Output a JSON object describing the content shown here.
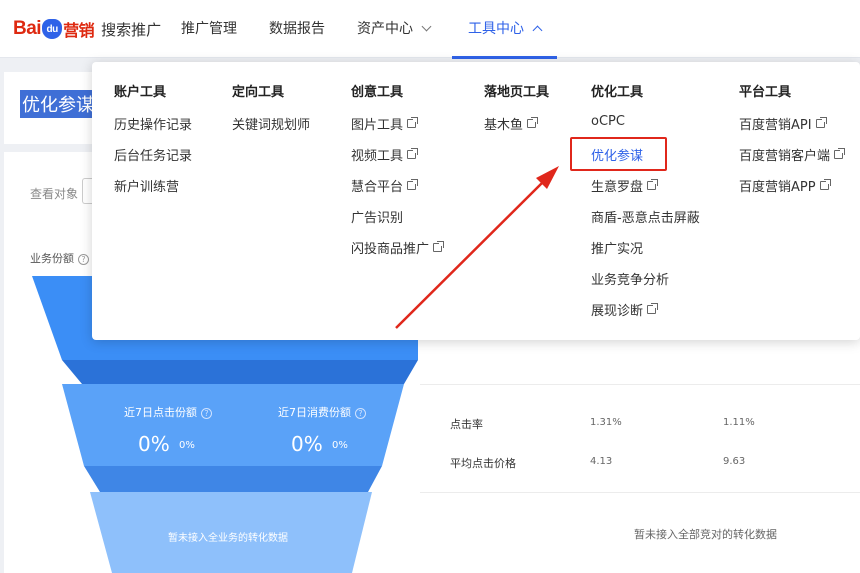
{
  "header": {
    "logo_text_1": "Bai",
    "logo_paw": "du",
    "logo_text_2": "营销",
    "product": "搜索推广",
    "nav": [
      {
        "label": "推广管理"
      },
      {
        "label": "数据报告"
      },
      {
        "label": "资产中心"
      },
      {
        "label": "工具中心"
      }
    ]
  },
  "page": {
    "title": "优化参谋",
    "view_label": "查看对象",
    "share_label": "业务份额",
    "funnel": {
      "click_share_label": "近7日点击份额",
      "click_share_value": "0%",
      "click_share_sub": "0%",
      "cost_share_label": "近7日消费份额",
      "cost_share_value": "0%",
      "cost_share_sub": "0%",
      "conversion_note": "暂未接入全业务的转化数据"
    },
    "table": {
      "rows": [
        {
          "name": "点击率",
          "v1": "1.31%",
          "v2": "1.11%"
        },
        {
          "name": "平均点击价格",
          "v1": "4.13",
          "v2": "9.63"
        }
      ],
      "empty_note": "暂未接入全部竞对的转化数据"
    }
  },
  "dropdown": {
    "columns": [
      {
        "title": "账户工具",
        "items": [
          "历史操作记录",
          "后台任务记录",
          "新户训练营"
        ]
      },
      {
        "title": "定向工具",
        "items": [
          "关键词规划师"
        ]
      },
      {
        "title": "创意工具",
        "items": [
          "图片工具",
          "视频工具",
          "慧合平台",
          "广告识别",
          "闪投商品推广"
        ]
      },
      {
        "title": "落地页工具",
        "items": [
          "基木鱼"
        ]
      },
      {
        "title": "优化工具",
        "items": [
          "oCPC",
          "优化参谋",
          "生意罗盘",
          "商盾-恶意点击屏蔽",
          "推广实况",
          "业务竞争分析",
          "展现诊断"
        ]
      },
      {
        "title": "平台工具",
        "items": [
          "百度营销API",
          "百度营销客户端",
          "百度营销APP"
        ]
      }
    ]
  },
  "colors": {
    "accent": "#2f62e8",
    "highlight_box": "#e0271b",
    "arrow": "#e0271b",
    "funnel_top": "#3b8ef6",
    "funnel_mid": "#5aa2f8",
    "funnel_bottom": "#8ec0fb"
  }
}
